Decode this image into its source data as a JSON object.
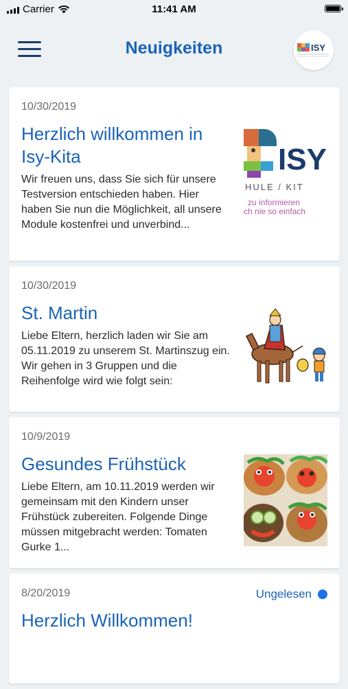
{
  "status_bar": {
    "carrier": "Carrier",
    "time": "11:41 AM"
  },
  "header": {
    "title": "Neuigkeiten",
    "menu_icon": "hamburger-menu-icon",
    "logo_text": "ISY"
  },
  "news": [
    {
      "date": "10/30/2019",
      "title": "Herzlich willkommen in Isy-Kita",
      "excerpt": "Wir freuen uns, dass Sie sich für unsere Testversion entschieden haben. Hier haben Sie nun die Möglichkeit, all unsere Module kostenfrei und unverbind...",
      "thumb_text": "ISY",
      "thumb_line1": "HULE / KIT",
      "thumb_line2": "zu informieren",
      "thumb_line3": "ch nie so einfach"
    },
    {
      "date": "10/30/2019",
      "title": "St. Martin",
      "excerpt": "Liebe Eltern, herzlich laden wir Sie am 05.11.2019 zu unserem St. Martinszug ein. Wir gehen in 3 Gruppen und die Reihenfolge wird wie folgt sein:"
    },
    {
      "date": "10/9/2019",
      "title": "Gesundes Frühstück",
      "excerpt": "Liebe Eltern, am 10.11.2019 werden wir gemeinsam mit den Kindern unser Frühstück zubereiten. Folgende Dinge müssen mitgebracht werden: Tomaten Gurke 1..."
    },
    {
      "date": "8/20/2019",
      "title": "Herzlich Willkommen!",
      "unread_label": "Ungelesen"
    }
  ],
  "colors": {
    "accent": "#1a63b8",
    "unread_dot": "#1a73e8",
    "background": "#eef1f4"
  }
}
